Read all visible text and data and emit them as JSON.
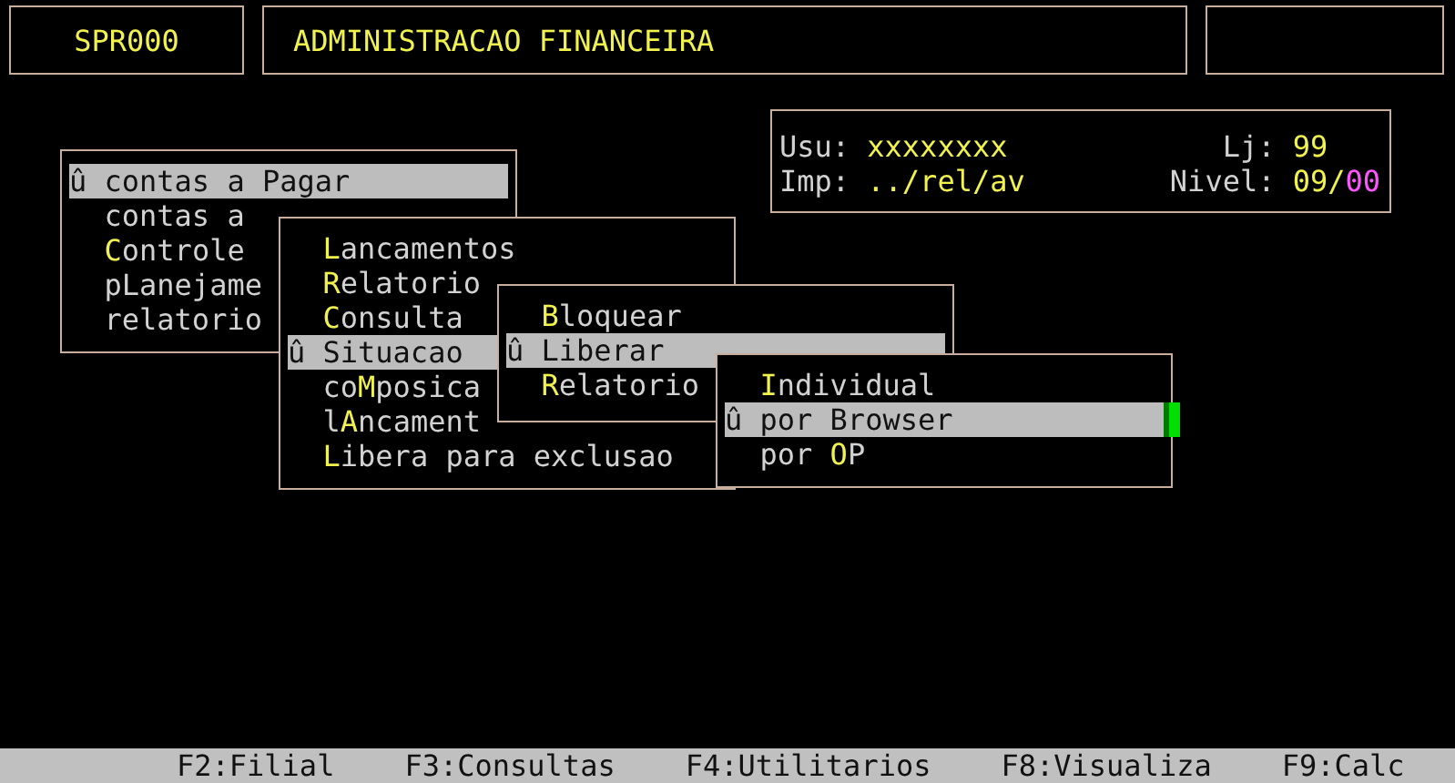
{
  "header": {
    "program": "SPR000",
    "title": "ADMINISTRACAO FINANCEIRA"
  },
  "info": {
    "rows": [
      {
        "label": "Usu:",
        "value": "xxxxxxxx",
        "right_label": "Lj:",
        "right_value": "99"
      },
      {
        "label": "Imp:",
        "value": "../rel/av",
        "right_label": "Nivel:",
        "right_value": "09/**00**"
      }
    ]
  },
  "menus": [
    {
      "items": [
        {
          "text": "û contas a Pagar",
          "selected": true
        },
        {
          "text": "contas a",
          "selected": false
        },
        {
          "text": "**C**ontrole",
          "selected": false
        },
        {
          "text": "pLanejame",
          "selected": false
        },
        {
          "text": "relatorio",
          "selected": false
        }
      ]
    },
    {
      "items": [
        {
          "text": "**L**ancamentos",
          "selected": false
        },
        {
          "text": "**R**elatorio",
          "selected": false
        },
        {
          "text": "**C**onsulta",
          "selected": false
        },
        {
          "text": "û Situacao",
          "selected": true
        },
        {
          "text": "co**M**posica",
          "selected": false
        },
        {
          "text": "l**A**ncament",
          "selected": false
        },
        {
          "text": "**L**ibera para exclusao",
          "selected": false
        }
      ]
    },
    {
      "items": [
        {
          "text": "**B**loquear",
          "selected": false
        },
        {
          "text": "û Liberar",
          "selected": true
        },
        {
          "text": "**R**elatorio",
          "selected": false
        }
      ]
    },
    {
      "items": [
        {
          "text": "**I**ndividual",
          "selected": false,
          "cursor": false
        },
        {
          "text": "û por Browser",
          "selected": true,
          "cursor": true
        },
        {
          "text": "por **O**P",
          "selected": false,
          "cursor": false
        }
      ]
    }
  ],
  "status_bar": [
    "F2:Filial",
    "F3:Consultas",
    "F4:Utilitarios",
    "F8:Visualiza",
    "F9:Calc"
  ]
}
